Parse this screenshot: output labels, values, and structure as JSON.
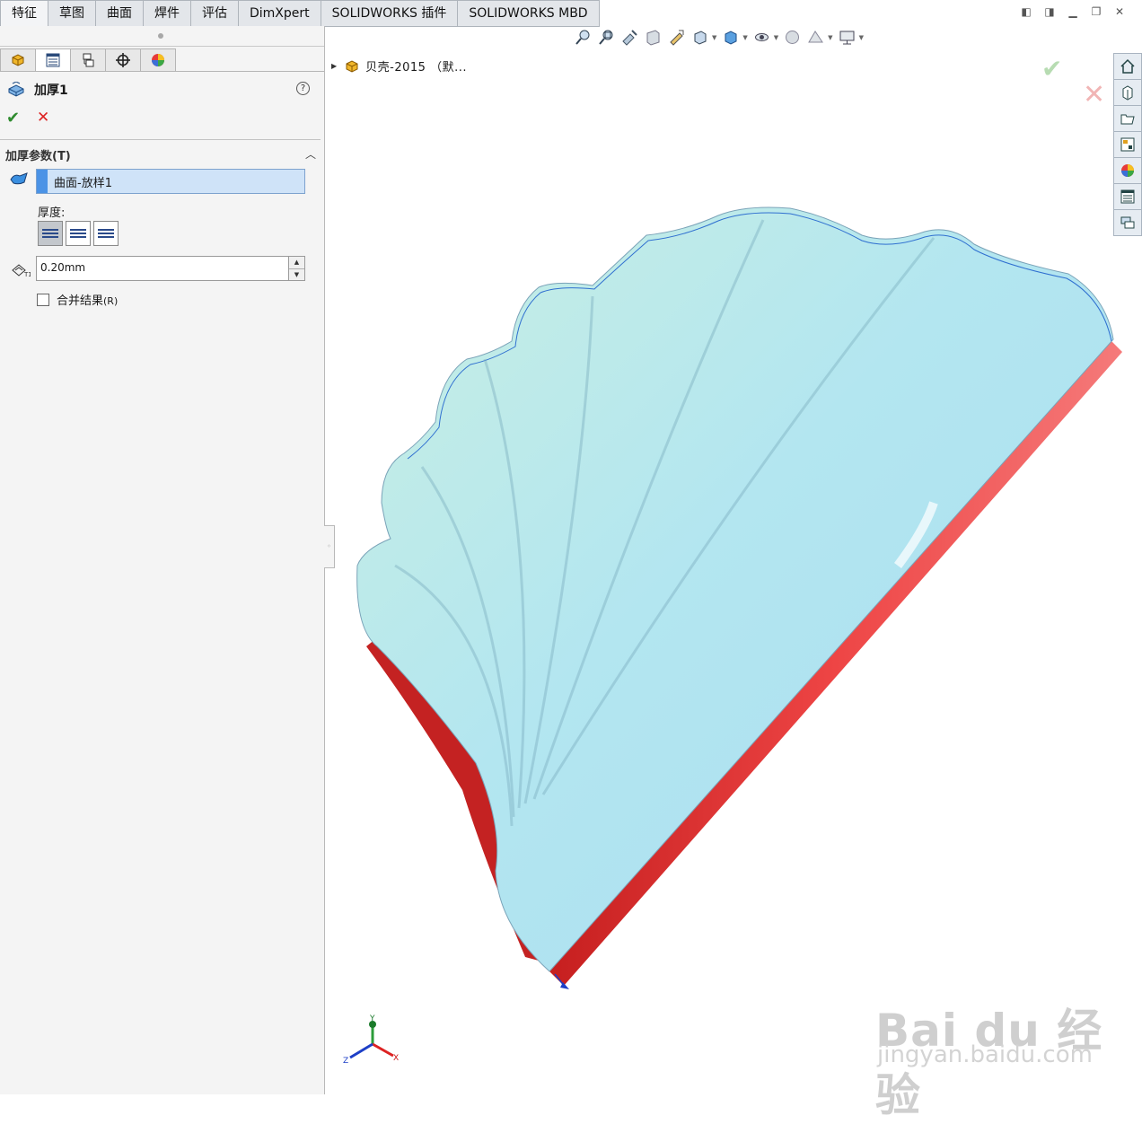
{
  "command_tabs": [
    "特征",
    "草图",
    "曲面",
    "焊件",
    "评估",
    "DimXpert",
    "SOLIDWORKS 插件",
    "SOLIDWORKS MBD"
  ],
  "property_manager": {
    "tab_icons": [
      "feature-manager-icon",
      "property-manager-icon",
      "configuration-manager-icon",
      "dimxpert-manager-icon",
      "display-manager-icon"
    ],
    "feature_title": "加厚1",
    "help_symbol": "?",
    "ok_symbol": "✔",
    "cancel_symbol": "✕",
    "group_title": "加厚参数(T)",
    "selected_surface": "曲面-放样1",
    "thickness_label": "厚度:",
    "thickness_value": "0.20mm",
    "merge_label": "合并结果",
    "merge_shortcut": "(R)",
    "merge_checked": false
  },
  "graphics": {
    "tree_item": "贝壳-2015  （默...",
    "confirm_ok": "✔",
    "confirm_cancel": "✕",
    "triad_labels": {
      "x": "X",
      "y": "Y",
      "z": "Z"
    },
    "colors": {
      "surface": "#b3e6f0",
      "thicken_side": "#e23a3a",
      "edge": "#2f6fd0"
    }
  },
  "watermark": {
    "brand": "Bai du 经验",
    "url": "jingyan.baidu.com"
  }
}
